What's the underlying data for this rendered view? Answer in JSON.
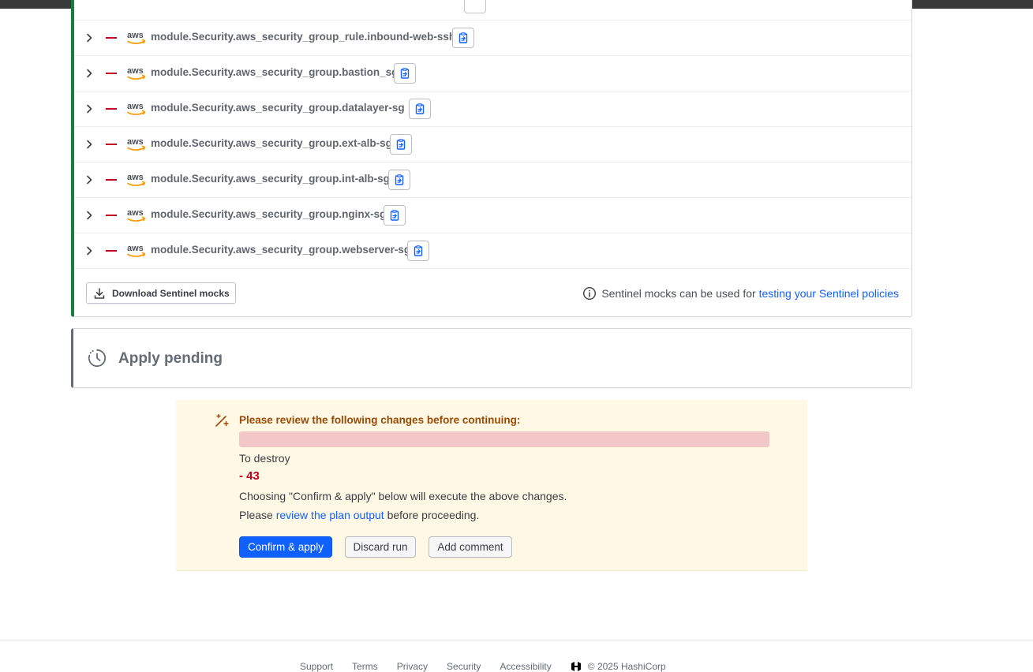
{
  "plan": {
    "resources": [
      {
        "name": "module.Security.aws_security_group_rule.inbound-web-ssh",
        "provider": "aws",
        "action": "destroy"
      },
      {
        "name": "module.Security.aws_security_group.bastion_sg",
        "provider": "aws",
        "action": "destroy"
      },
      {
        "name": "module.Security.aws_security_group.datalayer-sg",
        "provider": "aws",
        "action": "destroy"
      },
      {
        "name": "module.Security.aws_security_group.ext-alb-sg",
        "provider": "aws",
        "action": "destroy"
      },
      {
        "name": "module.Security.aws_security_group.int-alb-sg",
        "provider": "aws",
        "action": "destroy"
      },
      {
        "name": "module.Security.aws_security_group.nginx-sg",
        "provider": "aws",
        "action": "destroy"
      },
      {
        "name": "module.Security.aws_security_group.webserver-sg",
        "provider": "aws",
        "action": "destroy"
      }
    ],
    "download_label": "Download Sentinel mocks",
    "mock_note_prefix": "Sentinel mocks can be used for",
    "mock_note_link": "testing your Sentinel policies"
  },
  "apply": {
    "title": "Apply pending"
  },
  "review": {
    "title": "Please review the following changes before continuing:",
    "destroy_label": "To destroy",
    "destroy_count": "- 43",
    "explain": "Choosing \"Confirm & apply\" below will execute the above changes.",
    "please_prefix": "Please",
    "please_link": "review the plan output",
    "please_suffix": "before proceeding.",
    "confirm_label": "Confirm & apply",
    "discard_label": "Discard run",
    "comment_label": "Add comment"
  },
  "footer": {
    "links": [
      "Support",
      "Terms",
      "Privacy",
      "Security",
      "Accessibility"
    ],
    "copyright": "© 2025 HashiCorp"
  },
  "colors": {
    "destroy": "#c00021",
    "link": "#1060ff",
    "applied_border": "#15803d",
    "warning_bg": "#fff8e4"
  }
}
